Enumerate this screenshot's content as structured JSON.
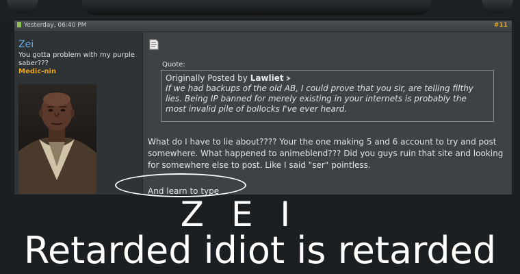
{
  "post": {
    "date": "Yesterday, 06:40 PM",
    "number": "#11",
    "username": "Zei",
    "user_title": "You gotta problem with my purple saber???",
    "rank": "Medic-nin",
    "quote_label": "Quote:",
    "quote_prefix": "Originally Posted by",
    "quote_author": "Lawliet",
    "quote_text": "If we had backups of the old AB, I could prove that you sir, are telling filthy lies. Being IP banned for merely existing in your internets is probably the most invalid pile of bollocks I've ever heard.",
    "message": "What do I have to lie about???? Your the one making 5 and 6 account to try and post somewhere. What happened to animeblend??? Did you guys ruin that site and looking for somewhere else to post. Like I said \"ser\" pointless.",
    "last_line": "And learn to type"
  },
  "caption": {
    "line1": "Z E I",
    "line2": "Retarded idiot is retarded"
  },
  "icons": {
    "post_icon": "document-icon",
    "quote_link": "view-post-icon"
  }
}
